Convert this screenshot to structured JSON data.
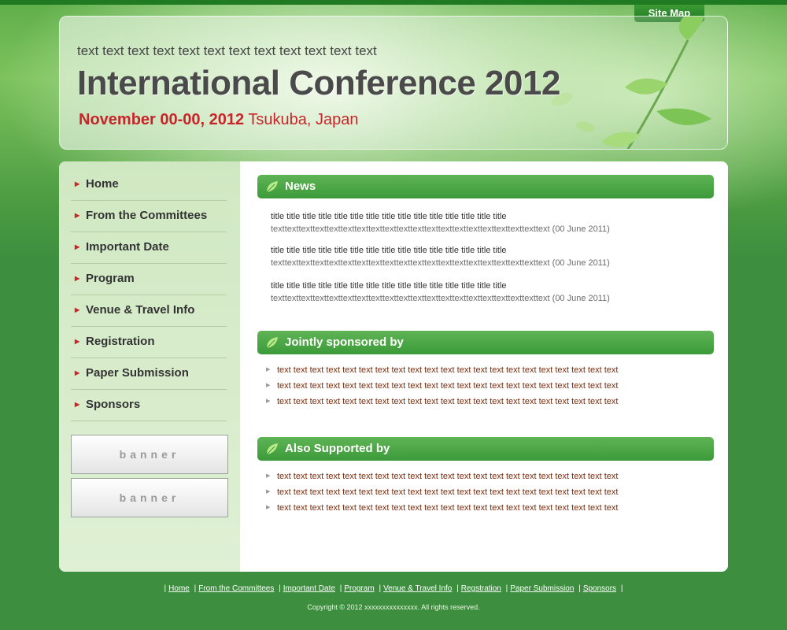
{
  "site_map_label": "Site Map",
  "header": {
    "subtitle": "text text text text text text text text text text text text",
    "title": "International Conference 2012",
    "date": "November 00-00, 2012",
    "location": "Tsukuba, Japan"
  },
  "nav": [
    "Home",
    "From the Committees",
    "Important Date",
    "Program",
    "Venue & Travel Info",
    "Registration",
    "Paper Submission",
    "Sponsors"
  ],
  "banners": [
    "banner",
    "banner"
  ],
  "news": {
    "heading": "News",
    "items": [
      {
        "title": "title title title title title title title title title title title title title title title",
        "body": "texttexttexttexttexttexttexttexttexttexttexttexttexttexttexttexttexttexttexttext (00 June 2011)"
      },
      {
        "title": "title title title title title title title title title title title title title title title",
        "body": "texttexttexttexttexttexttexttexttexttexttexttexttexttexttexttexttexttexttexttext (00 June 2011)"
      },
      {
        "title": "title title title title title title title title title title title title title title title",
        "body": "texttexttexttexttexttexttexttexttexttexttexttexttexttexttexttexttexttexttexttext (00 June 2011)"
      }
    ]
  },
  "jointly": {
    "heading": "Jointly sponsored by",
    "items": [
      "text text text text text text text text text text text text text text text text text text text text text",
      "text text text text text text text text text text text text text text text text text text text text text",
      "text text text text text text text text text text text text text text text text text text text text text"
    ]
  },
  "also": {
    "heading": "Also Supported by",
    "items": [
      "text text text text text text text text text text text text text text text text text text text text text",
      "text text text text text text text text text text text text text text text text text text text text text",
      "text text text text text text text text text text text text text text text text text text text text text"
    ]
  },
  "footer": {
    "links": [
      "Home",
      "From the Committees",
      "Important Date",
      "Program",
      "Venue & Travel Info",
      "Regstration",
      "Paper Submission",
      "Sponsors"
    ],
    "separator": "|",
    "copyright": "Copyright © 2012 xxxxxxxxxxxxxxx. All rights reserved."
  },
  "colors": {
    "accent_green": "#3c9a3a",
    "date_red": "#c8242a",
    "background": "#3d8f3f"
  }
}
